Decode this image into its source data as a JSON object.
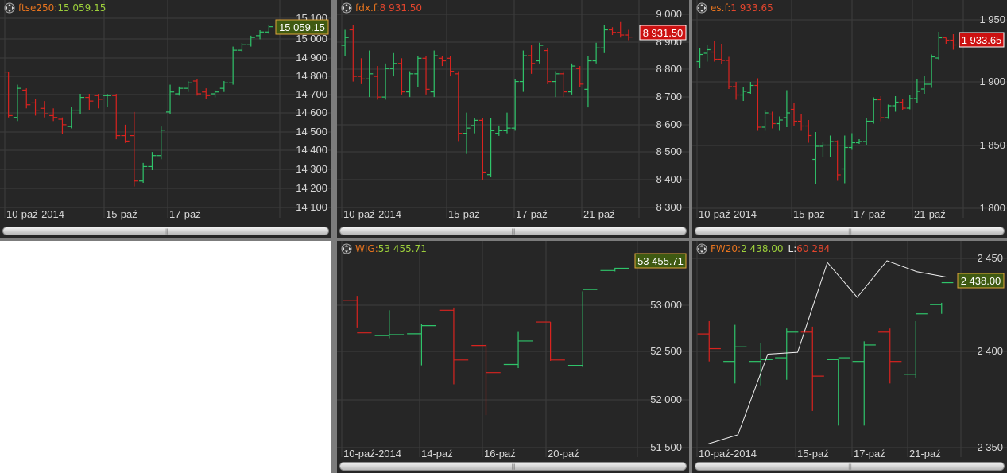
{
  "colors": {
    "up": "#2fc46a",
    "down": "#d9231f",
    "grid": "#3d3d3d",
    "axis_text": "#d8d8d8",
    "symbol": "#e8741e",
    "value_green": "#9ccf3b",
    "value_red": "#e2452d",
    "label_green_bg": "#3f5a12",
    "label_red_bg": "#cc1111"
  },
  "icons": {
    "move": "move-icon",
    "scroll_grip": "grip-icon"
  },
  "panels": [
    {
      "symbol": "ftse250:",
      "value": "15 059.15",
      "value_color": "green",
      "last_label": "15 059.15",
      "last_label_style": "green",
      "yticks": [
        "15 100",
        "15 000",
        "14 900",
        "14 800",
        "14 700",
        "14 600",
        "14 500",
        "14 400",
        "14 300",
        "14 200",
        "14 100"
      ],
      "xlabels": [
        "10-paź-2014",
        "15-paź",
        "17-paź"
      ]
    },
    {
      "symbol": "fdx.f:",
      "value": "8 931.50",
      "value_color": "red",
      "last_label": "8 931.50",
      "last_label_style": "red",
      "yticks": [
        "9 000",
        "8 900",
        "8 800",
        "8 700",
        "8 600",
        "8 500",
        "8 400",
        "8 300"
      ],
      "xlabels": [
        "10-paź-2014",
        "15-paź",
        "17-paź",
        "21-paź"
      ]
    },
    {
      "symbol": "es.f:",
      "value": "1 933.65",
      "value_color": "red",
      "last_label": "1 933.65",
      "last_label_style": "red",
      "yticks": [
        "1 950",
        "1 900",
        "1 850",
        "1 800"
      ],
      "xlabels": [
        "10-paź-2014",
        "15-paź",
        "17-paź",
        "21-paź"
      ]
    },
    {
      "symbol": "WIG:",
      "value": "53 455.71",
      "value_color": "green",
      "last_label": "53 455.71",
      "last_label_style": "green",
      "yticks": [
        "53 000",
        "52 500",
        "52 000",
        "51 500"
      ],
      "xlabels": [
        "10-paź-2014",
        "14-paź",
        "16-paź",
        "20-paź"
      ]
    },
    {
      "symbol": "FW20:",
      "value": "2 438.00",
      "value_color": "green",
      "volume_label": "L:",
      "volume_value": "60 284",
      "last_label": "2 438.00",
      "last_label_style": "green",
      "yticks": [
        "2 450",
        "2 400",
        "2 350"
      ],
      "xlabels": [
        "10-paź-2014",
        "15-paź",
        "17-paź",
        "21-paź"
      ]
    }
  ],
  "chart_data": [
    {
      "type": "ohlc",
      "title": "ftse250",
      "ylim": [
        14060,
        15110
      ],
      "bars": [
        {
          "o": 14810,
          "h": 14810,
          "l": 14560,
          "c": 14570
        },
        {
          "o": 14560,
          "h": 14740,
          "l": 14540,
          "c": 14720
        },
        {
          "o": 14710,
          "h": 14720,
          "l": 14610,
          "c": 14630
        },
        {
          "o": 14640,
          "h": 14660,
          "l": 14570,
          "c": 14600
        },
        {
          "o": 14610,
          "h": 14650,
          "l": 14560,
          "c": 14580
        },
        {
          "o": 14570,
          "h": 14610,
          "l": 14540,
          "c": 14560
        },
        {
          "o": 14550,
          "h": 14560,
          "l": 14470,
          "c": 14520
        },
        {
          "o": 14510,
          "h": 14620,
          "l": 14500,
          "c": 14600
        },
        {
          "o": 14600,
          "h": 14690,
          "l": 14580,
          "c": 14670
        },
        {
          "o": 14670,
          "h": 14690,
          "l": 14600,
          "c": 14650
        },
        {
          "o": 14680,
          "h": 14690,
          "l": 14610,
          "c": 14660
        },
        {
          "o": 14680,
          "h": 14690,
          "l": 14620,
          "c": 14680
        },
        {
          "o": 14680,
          "h": 14690,
          "l": 14440,
          "c": 14460
        },
        {
          "o": 14460,
          "h": 14520,
          "l": 14420,
          "c": 14430
        },
        {
          "o": 14460,
          "h": 14590,
          "l": 14180,
          "c": 14210
        },
        {
          "o": 14210,
          "h": 14310,
          "l": 14200,
          "c": 14290
        },
        {
          "o": 14290,
          "h": 14370,
          "l": 14270,
          "c": 14350
        },
        {
          "o": 14350,
          "h": 14510,
          "l": 14330,
          "c": 14490
        },
        {
          "o": 14590,
          "h": 14740,
          "l": 14580,
          "c": 14700
        },
        {
          "o": 14690,
          "h": 14730,
          "l": 14680,
          "c": 14720
        },
        {
          "o": 14720,
          "h": 14760,
          "l": 14700,
          "c": 14750
        },
        {
          "o": 14760,
          "h": 14770,
          "l": 14680,
          "c": 14690
        },
        {
          "o": 14700,
          "h": 14720,
          "l": 14660,
          "c": 14680
        },
        {
          "o": 14690,
          "h": 14710,
          "l": 14670,
          "c": 14700
        },
        {
          "o": 14720,
          "h": 14760,
          "l": 14700,
          "c": 14750
        },
        {
          "o": 14750,
          "h": 14950,
          "l": 14740,
          "c": 14930
        },
        {
          "o": 14930,
          "h": 14970,
          "l": 14920,
          "c": 14960
        },
        {
          "o": 14960,
          "h": 15010,
          "l": 14950,
          "c": 15000
        },
        {
          "o": 15010,
          "h": 15040,
          "l": 14990,
          "c": 15030
        },
        {
          "o": 15030,
          "h": 15070,
          "l": 15020,
          "c": 15059
        }
      ]
    },
    {
      "type": "ohlc",
      "title": "fdx.f",
      "ylim": [
        8270,
        9020
      ],
      "bars": [
        {
          "o": 8900,
          "h": 8960,
          "l": 8860,
          "c": 8930
        },
        {
          "o": 8960,
          "h": 8980,
          "l": 8760,
          "c": 8780
        },
        {
          "o": 8780,
          "h": 8850,
          "l": 8750,
          "c": 8770
        },
        {
          "o": 8770,
          "h": 8880,
          "l": 8700,
          "c": 8790
        },
        {
          "o": 8780,
          "h": 8820,
          "l": 8690,
          "c": 8700
        },
        {
          "o": 8700,
          "h": 8830,
          "l": 8690,
          "c": 8810
        },
        {
          "o": 8810,
          "h": 8870,
          "l": 8780,
          "c": 8830
        },
        {
          "o": 8830,
          "h": 8850,
          "l": 8710,
          "c": 8720
        },
        {
          "o": 8720,
          "h": 8800,
          "l": 8700,
          "c": 8790
        },
        {
          "o": 8790,
          "h": 8860,
          "l": 8740,
          "c": 8850
        },
        {
          "o": 8850,
          "h": 8860,
          "l": 8710,
          "c": 8730
        },
        {
          "o": 8720,
          "h": 8880,
          "l": 8700,
          "c": 8860
        },
        {
          "o": 8850,
          "h": 8860,
          "l": 8820,
          "c": 8840
        },
        {
          "o": 8850,
          "h": 8860,
          "l": 8780,
          "c": 8800
        },
        {
          "o": 8790,
          "h": 8800,
          "l": 8530,
          "c": 8560
        },
        {
          "o": 8560,
          "h": 8640,
          "l": 8480,
          "c": 8580
        },
        {
          "o": 8590,
          "h": 8620,
          "l": 8560,
          "c": 8610
        },
        {
          "o": 8610,
          "h": 8620,
          "l": 8380,
          "c": 8410
        },
        {
          "o": 8400,
          "h": 8620,
          "l": 8390,
          "c": 8570
        },
        {
          "o": 8560,
          "h": 8590,
          "l": 8550,
          "c": 8570
        },
        {
          "o": 8570,
          "h": 8640,
          "l": 8560,
          "c": 8580
        },
        {
          "o": 8580,
          "h": 8770,
          "l": 8570,
          "c": 8760
        },
        {
          "o": 8760,
          "h": 8880,
          "l": 8720,
          "c": 8860
        },
        {
          "o": 8860,
          "h": 8900,
          "l": 8790,
          "c": 8830
        },
        {
          "o": 8840,
          "h": 8910,
          "l": 8830,
          "c": 8900
        },
        {
          "o": 8880,
          "h": 8890,
          "l": 8750,
          "c": 8760
        },
        {
          "o": 8760,
          "h": 8800,
          "l": 8700,
          "c": 8790
        },
        {
          "o": 8790,
          "h": 8800,
          "l": 8700,
          "c": 8720
        },
        {
          "o": 8720,
          "h": 8830,
          "l": 8710,
          "c": 8820
        },
        {
          "o": 8810,
          "h": 8820,
          "l": 8740,
          "c": 8750
        },
        {
          "o": 8730,
          "h": 8860,
          "l": 8660,
          "c": 8840
        },
        {
          "o": 8840,
          "h": 8910,
          "l": 8830,
          "c": 8890
        },
        {
          "o": 8890,
          "h": 8980,
          "l": 8870,
          "c": 8960
        },
        {
          "o": 8960,
          "h": 8970,
          "l": 8940,
          "c": 8950
        },
        {
          "o": 8950,
          "h": 8990,
          "l": 8930,
          "c": 8940
        },
        {
          "o": 8940,
          "h": 8960,
          "l": 8920,
          "c": 8932
        }
      ]
    },
    {
      "type": "ohlc",
      "title": "es.f",
      "ylim": [
        1797,
        1957
      ],
      "bars": [
        {
          "o": 1920,
          "h": 1931,
          "l": 1915,
          "c": 1926
        },
        {
          "o": 1927,
          "h": 1934,
          "l": 1920,
          "c": 1930
        },
        {
          "o": 1928,
          "h": 1937,
          "l": 1920,
          "c": 1922
        },
        {
          "o": 1922,
          "h": 1935,
          "l": 1918,
          "c": 1921
        },
        {
          "o": 1921,
          "h": 1924,
          "l": 1897,
          "c": 1899
        },
        {
          "o": 1899,
          "h": 1903,
          "l": 1888,
          "c": 1892
        },
        {
          "o": 1892,
          "h": 1899,
          "l": 1887,
          "c": 1895
        },
        {
          "o": 1894,
          "h": 1903,
          "l": 1893,
          "c": 1900
        },
        {
          "o": 1900,
          "h": 1906,
          "l": 1862,
          "c": 1865
        },
        {
          "o": 1865,
          "h": 1879,
          "l": 1862,
          "c": 1877
        },
        {
          "o": 1876,
          "h": 1878,
          "l": 1864,
          "c": 1868
        },
        {
          "o": 1868,
          "h": 1874,
          "l": 1862,
          "c": 1871
        },
        {
          "o": 1873,
          "h": 1896,
          "l": 1865,
          "c": 1877
        },
        {
          "o": 1880,
          "h": 1885,
          "l": 1866,
          "c": 1870
        },
        {
          "o": 1870,
          "h": 1876,
          "l": 1862,
          "c": 1866
        },
        {
          "o": 1866,
          "h": 1871,
          "l": 1852,
          "c": 1858
        },
        {
          "o": 1838,
          "h": 1861,
          "l": 1817,
          "c": 1849
        },
        {
          "o": 1849,
          "h": 1853,
          "l": 1840,
          "c": 1850
        },
        {
          "o": 1850,
          "h": 1858,
          "l": 1840,
          "c": 1853
        },
        {
          "o": 1853,
          "h": 1854,
          "l": 1820,
          "c": 1825
        },
        {
          "o": 1830,
          "h": 1858,
          "l": 1818,
          "c": 1848
        },
        {
          "o": 1848,
          "h": 1860,
          "l": 1846,
          "c": 1852
        },
        {
          "o": 1852,
          "h": 1855,
          "l": 1851,
          "c": 1853
        },
        {
          "o": 1853,
          "h": 1873,
          "l": 1850,
          "c": 1870
        },
        {
          "o": 1870,
          "h": 1890,
          "l": 1868,
          "c": 1888
        },
        {
          "o": 1888,
          "h": 1891,
          "l": 1870,
          "c": 1873
        },
        {
          "o": 1873,
          "h": 1884,
          "l": 1872,
          "c": 1883
        },
        {
          "o": 1883,
          "h": 1891,
          "l": 1878,
          "c": 1886
        },
        {
          "o": 1886,
          "h": 1889,
          "l": 1879,
          "c": 1881
        },
        {
          "o": 1881,
          "h": 1892,
          "l": 1880,
          "c": 1889
        },
        {
          "o": 1889,
          "h": 1905,
          "l": 1885,
          "c": 1895
        },
        {
          "o": 1897,
          "h": 1908,
          "l": 1893,
          "c": 1901
        },
        {
          "o": 1901,
          "h": 1926,
          "l": 1898,
          "c": 1924
        },
        {
          "o": 1923,
          "h": 1945,
          "l": 1921,
          "c": 1940
        },
        {
          "o": 1940,
          "h": 1940,
          "l": 1935,
          "c": 1938
        },
        {
          "o": 1938,
          "h": 1943,
          "l": 1930,
          "c": 1934
        }
      ]
    },
    {
      "type": "ohlc",
      "title": "WIG",
      "ylim": [
        51470,
        53600
      ],
      "bars": [
        {
          "o": 53100,
          "h": 53150,
          "l": 52800,
          "c": 52740
        },
        {
          "o": 52710,
          "h": 52990,
          "l": 52680,
          "c": 52720
        },
        {
          "o": 52730,
          "h": 52840,
          "l": 52380,
          "c": 52820
        },
        {
          "o": 52990,
          "h": 53020,
          "l": 52170,
          "c": 52440
        },
        {
          "o": 52600,
          "h": 52610,
          "l": 51830,
          "c": 52300
        },
        {
          "o": 52390,
          "h": 52750,
          "l": 52350,
          "c": 52650
        },
        {
          "o": 52860,
          "h": 52860,
          "l": 52430,
          "c": 52440
        },
        {
          "o": 52380,
          "h": 53200,
          "l": 52360,
          "c": 53220
        },
        {
          "o": 53430,
          "h": 53460,
          "l": 53420,
          "c": 53455
        }
      ]
    },
    {
      "type": "ohlc+line",
      "title": "FW20",
      "ylim": [
        2348,
        2453
      ],
      "bars": [
        {
          "o": 2410,
          "h": 2417,
          "l": 2395,
          "c": 2402
        },
        {
          "o": 2395,
          "h": 2415,
          "l": 2383,
          "c": 2403
        },
        {
          "o": 2395,
          "h": 2405,
          "l": 2382,
          "c": 2396
        },
        {
          "o": 2397,
          "h": 2413,
          "l": 2385,
          "c": 2411
        },
        {
          "o": 2411,
          "h": 2414,
          "l": 2368,
          "c": 2387
        },
        {
          "o": 2396,
          "h": 2396,
          "l": 2360,
          "c": 2397
        },
        {
          "o": 2395,
          "h": 2406,
          "l": 2360,
          "c": 2404
        },
        {
          "o": 2411,
          "h": 2413,
          "l": 2383,
          "c": 2395
        },
        {
          "o": 2388,
          "h": 2417,
          "l": 2386,
          "c": 2421
        },
        {
          "o": 2426,
          "h": 2427,
          "l": 2421,
          "c": 2438
        }
      ],
      "line": [
        2350,
        2355,
        2399,
        2400,
        2449,
        2430,
        2450,
        2444,
        2441
      ]
    }
  ]
}
